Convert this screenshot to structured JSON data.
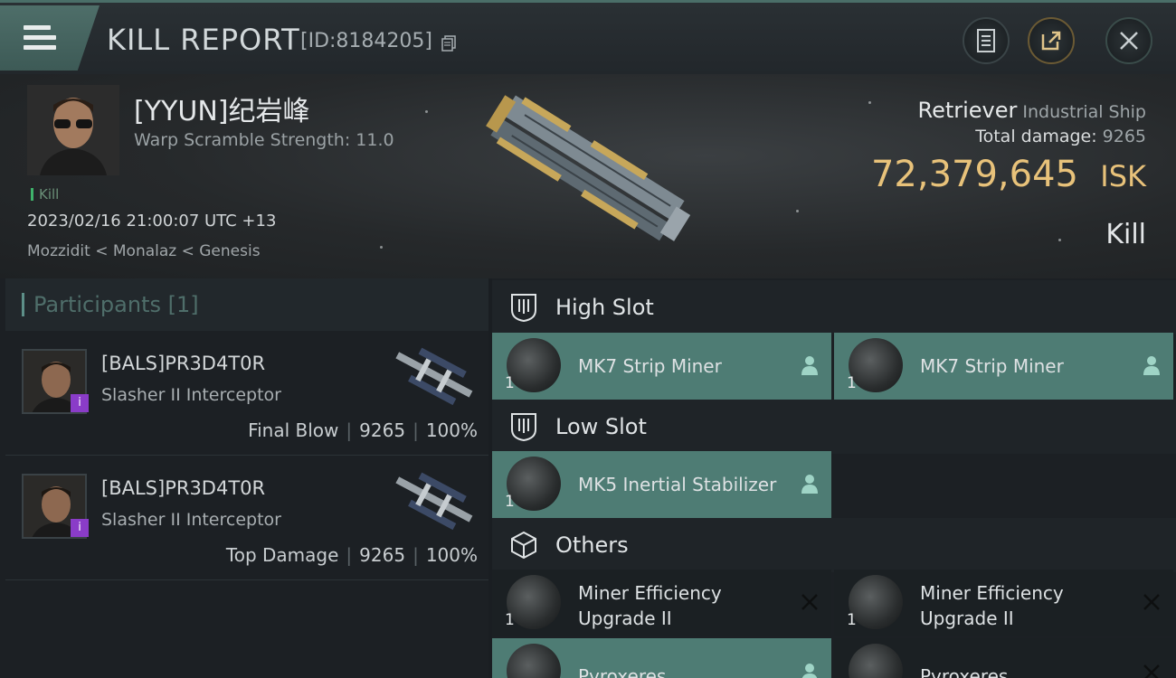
{
  "header": {
    "title": "KILL REPORT",
    "id_text": "[ID:8184205]"
  },
  "victim": {
    "pilot_name": "[YYUN]纪岩峰",
    "warp_scramble": "Warp Scramble Strength: 11.0",
    "kill_tag": "Kill",
    "datetime": "2023/02/16 21:00:07 UTC +13",
    "location": "Mozzidit < Monalaz < Genesis",
    "ship_name": "Retriever",
    "ship_class": "Industrial Ship",
    "total_damage_label": "Total damage:",
    "total_damage": "9265",
    "isk_value": "72,379,645",
    "isk_unit": "ISK",
    "result": "Kill"
  },
  "participants": {
    "label": "Participants",
    "count": "[1]",
    "items": [
      {
        "name": "[BALS]PR3D4T0R",
        "ship": "Slasher II Interceptor",
        "role": "Final Blow",
        "damage": "9265",
        "percent": "100%",
        "badge": "i"
      },
      {
        "name": "[BALS]PR3D4T0R",
        "ship": "Slasher II Interceptor",
        "role": "Top Damage",
        "damage": "9265",
        "percent": "100%",
        "badge": "i"
      }
    ]
  },
  "fitting": {
    "high_slot": {
      "label": "High Slot",
      "items": [
        {
          "name": "MK7 Strip Miner",
          "qty": "1",
          "status": "fitted"
        },
        {
          "name": "MK7 Strip Miner",
          "qty": "1",
          "status": "fitted"
        }
      ]
    },
    "low_slot": {
      "label": "Low Slot",
      "items": [
        {
          "name": "MK5 Inertial Stabilizer",
          "qty": "1",
          "status": "fitted"
        }
      ]
    },
    "others": {
      "label": "Others",
      "items": [
        {
          "name_line1": "Miner Efficiency",
          "name_line2": "Upgrade II",
          "qty": "1",
          "status": "destroyed"
        },
        {
          "name_line1": "Miner Efficiency",
          "name_line2": "Upgrade II",
          "qty": "1",
          "status": "destroyed"
        },
        {
          "name": "Pyroxeres",
          "status": "fitted"
        },
        {
          "name": "Pyroxeres",
          "status": "destroyed"
        }
      ]
    }
  },
  "colors": {
    "accent_teal": "#4e7c74",
    "isk_gold": "#e8c27a",
    "badge_purple": "#8a3cc8",
    "kill_green": "#3fb36b"
  },
  "icons": {
    "menu": "hamburger-menu-icon",
    "copy": "copy-icon",
    "notes": "notes-icon",
    "share": "share-icon",
    "close": "close-icon",
    "high_slot": "high-slot-icon",
    "low_slot": "low-slot-icon",
    "others": "cube-icon",
    "fitted": "person-icon",
    "destroyed": "x-icon"
  }
}
